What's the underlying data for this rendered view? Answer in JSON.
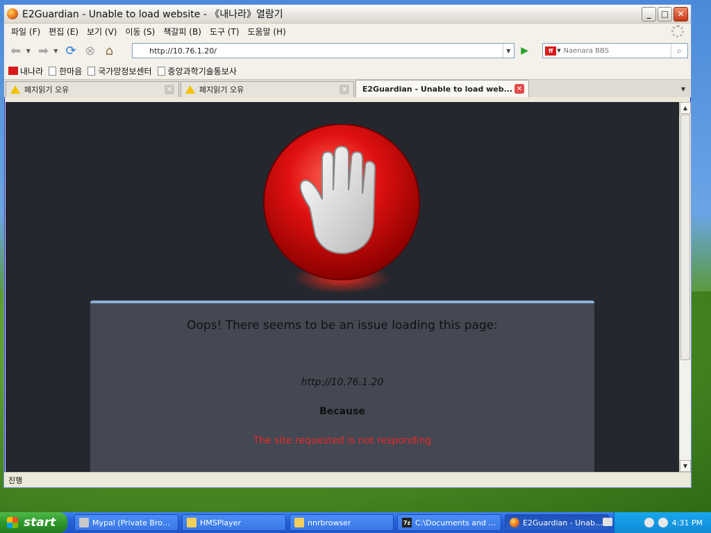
{
  "window": {
    "title": "E2Guardian - Unable to load website - 《내나라》열람기"
  },
  "menu": {
    "items": [
      "파일 (F)",
      "편집 (E)",
      "보기 (V)",
      "이동 (S)",
      "책갈피 (B)",
      "도구 (T)",
      "도움말 (H)"
    ]
  },
  "nav": {
    "url": "http://10.76.1.20/",
    "search_placeholder": "Naenara BBS",
    "engine_logo": "ff"
  },
  "bookmarks": [
    "내나라",
    "한마음",
    "국가망정보센터",
    "중앙과학기술통보사"
  ],
  "tabs": [
    {
      "label": "페지읽기 오유",
      "icon": "warning-icon"
    },
    {
      "label": "페지읽기 오유",
      "icon": "warning-icon"
    },
    {
      "label": "E2Guardian - Unable to load web...",
      "active": true
    }
  ],
  "page": {
    "title": "Oops! There seems to be an issue loading this page:",
    "url": "http://10.76.1.20",
    "because": "Because",
    "reason": "The site requested is not responding",
    "reason_color": "#e82828",
    "background": "#24272e",
    "panel_color": "#434852"
  },
  "status": {
    "text": "진행"
  },
  "taskbar": {
    "start": "start",
    "items": [
      {
        "label": "Mypal (Private Brow...",
        "icon": "app-icon"
      },
      {
        "label": "HMSPlayer",
        "icon": "folder-icon"
      },
      {
        "label": "nnrbrowser",
        "icon": "folder-icon"
      },
      {
        "label": "C:\\Documents and S...",
        "icon": "7zip-icon",
        "icon_text": "7z"
      },
      {
        "label": "E2Guardian - Unable...",
        "icon": "firefox-icon",
        "active": true
      }
    ],
    "clock": "4:31 PM"
  }
}
